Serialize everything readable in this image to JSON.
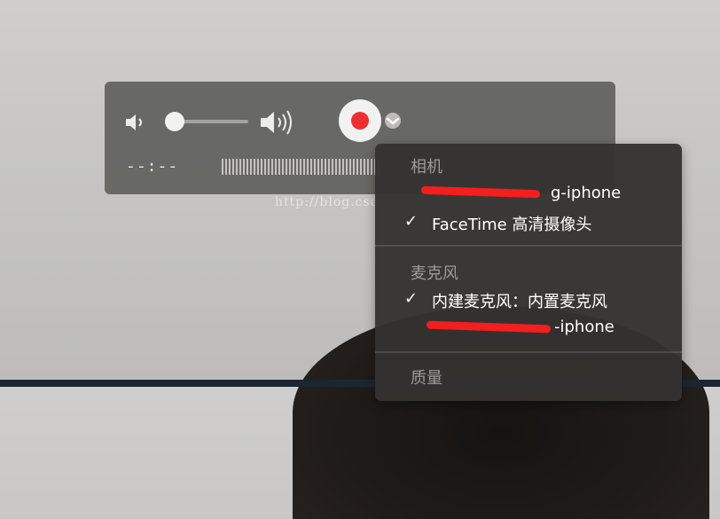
{
  "watermark": "http://blog.csdn.net/",
  "player": {
    "time": "--:--",
    "volume": 0.0,
    "record_color": "#ee2f2f"
  },
  "menu": {
    "camera_header": "相机",
    "camera_items": [
      "g-iphone",
      "FaceTime 高清摄像头"
    ],
    "camera_selected": "FaceTime 高清摄像头",
    "mic_header": "麦克风",
    "mic_items": [
      "内建麦克风：内置麦克风",
      "-iphone"
    ],
    "mic_selected": "内建麦克风：内置麦克风",
    "quality_header": "质量",
    "check_glyph": "✓"
  },
  "icons": {
    "volume_low": "speaker-low-icon",
    "volume_high": "speaker-high-icon",
    "record": "record-icon",
    "chevron": "chevron-down-icon"
  }
}
